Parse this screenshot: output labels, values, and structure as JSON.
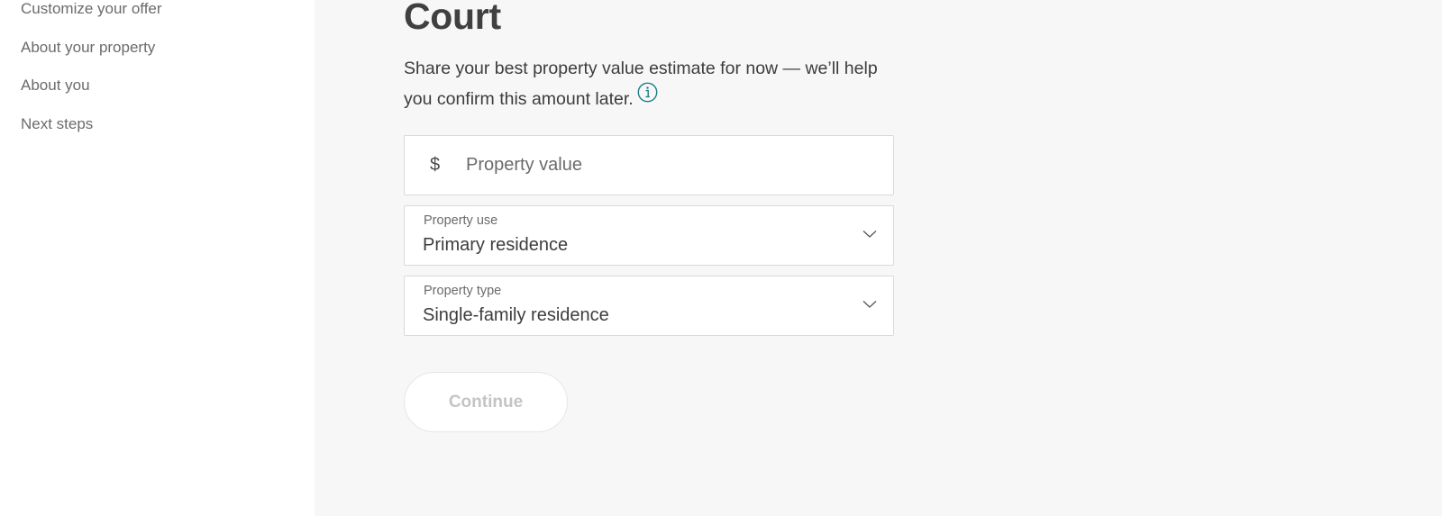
{
  "sidebar": {
    "items": [
      {
        "label": "Customize your offer"
      },
      {
        "label": "About your property"
      },
      {
        "label": "About you"
      },
      {
        "label": "Next steps"
      }
    ]
  },
  "main": {
    "title": "Court",
    "description": "Share your best property value estimate for now — we’ll help you confirm this amount later.",
    "info_icon": "info-circle-icon",
    "property_value": {
      "currency_symbol": "$",
      "placeholder": "Property value",
      "value": ""
    },
    "property_use": {
      "label": "Property use",
      "selected": "Primary residence"
    },
    "property_type": {
      "label": "Property type",
      "selected": "Single-family residence"
    },
    "continue_label": "Continue",
    "continue_disabled": true
  },
  "colors": {
    "accent": "#1a7f86",
    "main_background": "#f7f7f7",
    "sidebar_background": "#ffffff",
    "disabled_text": "#c4c4c4"
  }
}
